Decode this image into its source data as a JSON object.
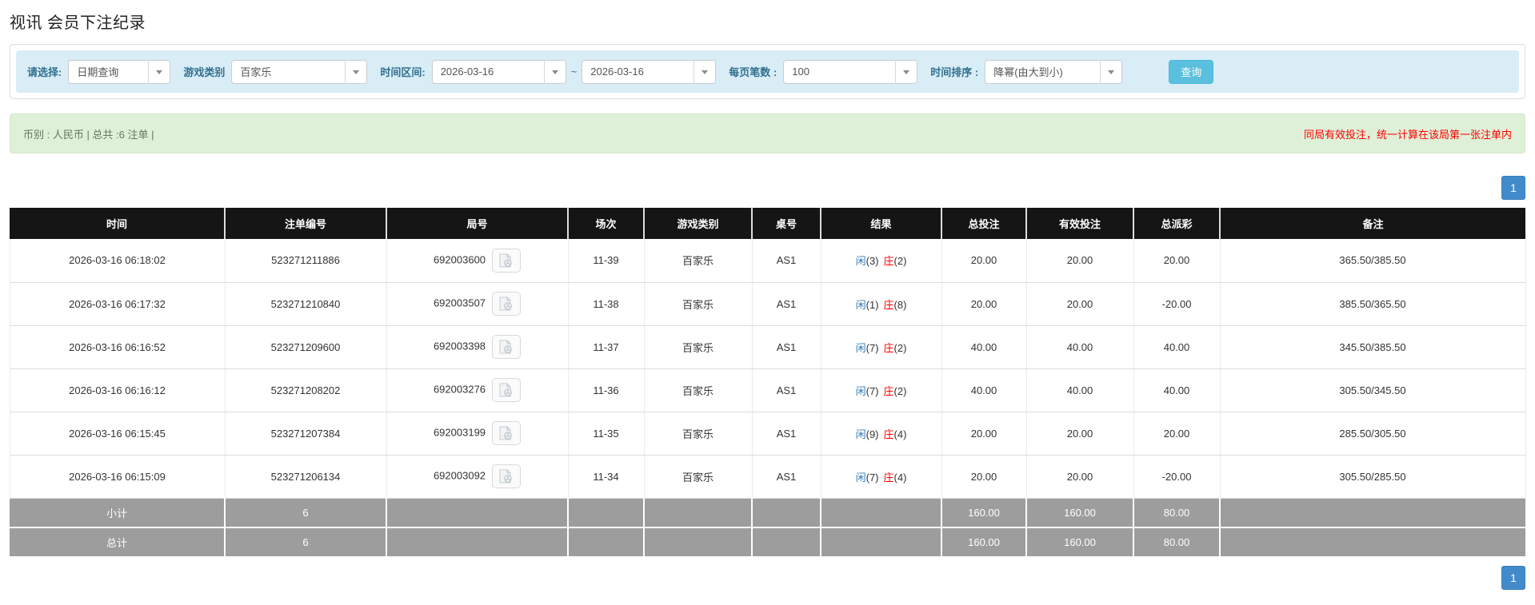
{
  "page": {
    "title": "视讯 会员下注纪录"
  },
  "filters": {
    "select_label": "请选择:",
    "select_value": "日期查询",
    "game_type_label": "游戏类别",
    "game_type_value": "百家乐",
    "date_range_label": "时间区间:",
    "date_from": "2026-03-16",
    "date_separator": "~",
    "date_to": "2026-03-16",
    "page_size_label": "每页笔数 :",
    "page_size_value": "100",
    "sort_label": "时间排序 :",
    "sort_value": "降幂(由大到小)",
    "search_button": "查询"
  },
  "summary_bar": {
    "left_text": "币别 : 人民币 | 总共 :6 注单 |",
    "right_notice": "同局有效投注，统一计算在该局第一张注单内"
  },
  "pagination": {
    "page": "1"
  },
  "table": {
    "headers": [
      "时间",
      "注单编号",
      "局号",
      "场次",
      "游戏类别",
      "桌号",
      "结果",
      "总投注",
      "有效投注",
      "总派彩",
      "备注"
    ],
    "rows": [
      {
        "time": "2026-03-16 06:18:02",
        "bet_id": "523271211886",
        "round_id": "692003600",
        "session": "11-39",
        "game": "百家乐",
        "table": "AS1",
        "result": {
          "player_label": "闲",
          "player_value": "(3)",
          "banker_label": "庄",
          "banker_value": "(2)"
        },
        "total_bet": "20.00",
        "valid_bet": "20.00",
        "payout": "20.00",
        "remark": "365.50/385.50"
      },
      {
        "time": "2026-03-16 06:17:32",
        "bet_id": "523271210840",
        "round_id": "692003507",
        "session": "11-38",
        "game": "百家乐",
        "table": "AS1",
        "result": {
          "player_label": "闲",
          "player_value": "(1)",
          "banker_label": "庄",
          "banker_value": "(8)"
        },
        "total_bet": "20.00",
        "valid_bet": "20.00",
        "payout": "-20.00",
        "remark": "385.50/365.50"
      },
      {
        "time": "2026-03-16 06:16:52",
        "bet_id": "523271209600",
        "round_id": "692003398",
        "session": "11-37",
        "game": "百家乐",
        "table": "AS1",
        "result": {
          "player_label": "闲",
          "player_value": "(7)",
          "banker_label": "庄",
          "banker_value": "(2)"
        },
        "total_bet": "40.00",
        "valid_bet": "40.00",
        "payout": "40.00",
        "remark": "345.50/385.50"
      },
      {
        "time": "2026-03-16 06:16:12",
        "bet_id": "523271208202",
        "round_id": "692003276",
        "session": "11-36",
        "game": "百家乐",
        "table": "AS1",
        "result": {
          "player_label": "闲",
          "player_value": "(7)",
          "banker_label": "庄",
          "banker_value": "(2)"
        },
        "total_bet": "40.00",
        "valid_bet": "40.00",
        "payout": "40.00",
        "remark": "305.50/345.50"
      },
      {
        "time": "2026-03-16 06:15:45",
        "bet_id": "523271207384",
        "round_id": "692003199",
        "session": "11-35",
        "game": "百家乐",
        "table": "AS1",
        "result": {
          "player_label": "闲",
          "player_value": "(9)",
          "banker_label": "庄",
          "banker_value": "(4)"
        },
        "total_bet": "20.00",
        "valid_bet": "20.00",
        "payout": "20.00",
        "remark": "285.50/305.50"
      },
      {
        "time": "2026-03-16 06:15:09",
        "bet_id": "523271206134",
        "round_id": "692003092",
        "session": "11-34",
        "game": "百家乐",
        "table": "AS1",
        "result": {
          "player_label": "闲",
          "player_value": "(7)",
          "banker_label": "庄",
          "banker_value": "(4)"
        },
        "total_bet": "20.00",
        "valid_bet": "20.00",
        "payout": "-20.00",
        "remark": "305.50/285.50"
      }
    ],
    "subtotal": {
      "label": "小计",
      "count": "6",
      "total_bet": "160.00",
      "valid_bet": "160.00",
      "payout": "80.00"
    },
    "total": {
      "label": "总计",
      "count": "6",
      "total_bet": "160.00",
      "valid_bet": "160.00",
      "payout": "80.00"
    }
  },
  "colors": {
    "accent_blue": "#337ab7",
    "negative_red": "#ff0000",
    "search_button_bg": "#5bc0de",
    "pagination_bg": "#428bca",
    "table_header_bg": "#151515",
    "summary_row_bg": "#9d9d9d",
    "filter_bar_bg": "#d9edf7",
    "notice_bar_bg": "#dff0d8"
  }
}
